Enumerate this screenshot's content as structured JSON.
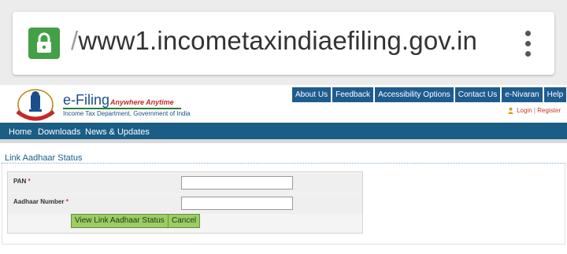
{
  "browser": {
    "url_prefix": "/",
    "url": "www1.incometaxindiaefiling.gov.in",
    "lock_icon": "lock-icon",
    "menu_icon": "more-vert-icon",
    "lock_color": "#43a047"
  },
  "site": {
    "brand": "e-Filing",
    "tagline": "Anywhere Anytime",
    "department": "Income Tax Department, Government of India",
    "top_nav": [
      "About Us",
      "Feedback",
      "Accessibility Options",
      "Contact Us",
      "e-Nivaran",
      "Help"
    ],
    "login": "Login",
    "login_sep": "|",
    "register": "Register",
    "main_nav": [
      "Home",
      "Downloads",
      "News & Updates"
    ],
    "accent": "#1a5e86"
  },
  "form": {
    "title": "Link Aadhaar Status",
    "pan_label": "PAN",
    "aadhaar_label": "Aadhaar Number",
    "required_mark": "*",
    "pan_value": "",
    "aadhaar_value": "",
    "view_button": "View Link Aadhaar Status",
    "cancel_button": "Cancel",
    "button_color": "#9ccc65"
  }
}
